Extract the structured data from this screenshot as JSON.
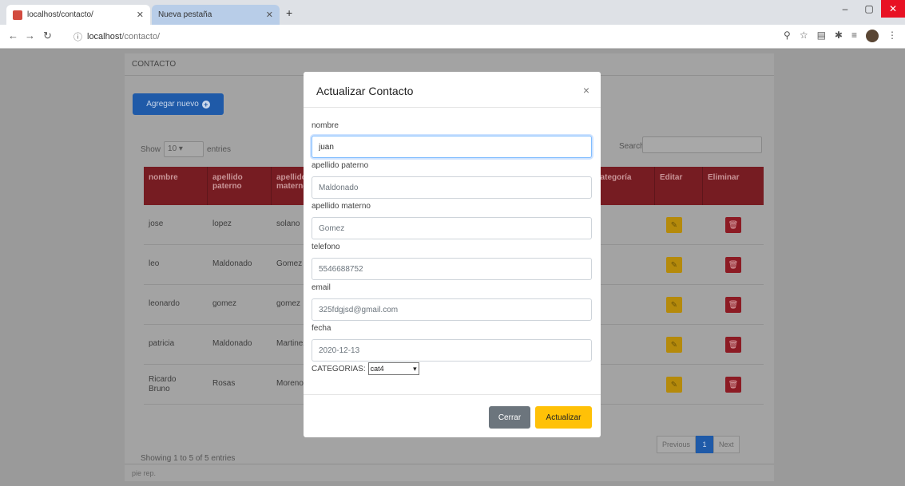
{
  "browser": {
    "tabs": [
      {
        "title": "localhost/contacto/",
        "active": true
      },
      {
        "title": "Nueva pestaña",
        "active": false
      }
    ],
    "new_tab": "+",
    "url_host": "localhost",
    "url_path": "/contacto/",
    "window_buttons": {
      "minimize": "–",
      "maximize": "▢",
      "close": "✕"
    }
  },
  "page": {
    "header": "CONTACTO",
    "add_button": "Agregar nuevo",
    "show_label": "Show",
    "show_value": "10",
    "entries_label": "entries",
    "search_label": "Search:",
    "columns": [
      "nombre",
      "apellido paterno",
      "apellido materno",
      "categoría",
      "Editar",
      "Eliminar"
    ],
    "rows": [
      {
        "nombre": "jose",
        "apellido_paterno": "lopez",
        "apellido_materno": "solano"
      },
      {
        "nombre": "leo",
        "apellido_paterno": "Maldonado",
        "apellido_materno": "Gomez"
      },
      {
        "nombre": "leonardo",
        "apellido_paterno": "gomez",
        "apellido_materno": "gomez"
      },
      {
        "nombre": "patricia",
        "apellido_paterno": "Maldonado",
        "apellido_materno": "Martinez"
      },
      {
        "nombre": "Ricardo Bruno",
        "apellido_paterno": "Rosas",
        "apellido_materno": "Moreno"
      }
    ],
    "showing": "Showing 1 to 5 of 5 entries",
    "pager": {
      "previous": "Previous",
      "current": "1",
      "next": "Next"
    },
    "footer": "pie rep."
  },
  "modal": {
    "title": "Actualizar Contacto",
    "close": "×",
    "fields": [
      {
        "label": "nombre",
        "value": "juan"
      },
      {
        "label": "apellido paterno",
        "value": "Maldonado"
      },
      {
        "label": "apellido materno",
        "value": "Gomez"
      },
      {
        "label": "telefono",
        "value": "5546688752"
      },
      {
        "label": "email",
        "value": "325fdgjsd@gmail.com"
      },
      {
        "label": "fecha",
        "value": "2020-12-13"
      }
    ],
    "category_label": "CATEGORIAS:",
    "category_value": "cat4",
    "cancel_button": "Cerrar",
    "submit_button": "Actualizar"
  },
  "colors": {
    "primary": "#007bff",
    "table_header": "#dc3545",
    "warning": "#ffc107",
    "secondary": "#6c757d"
  }
}
